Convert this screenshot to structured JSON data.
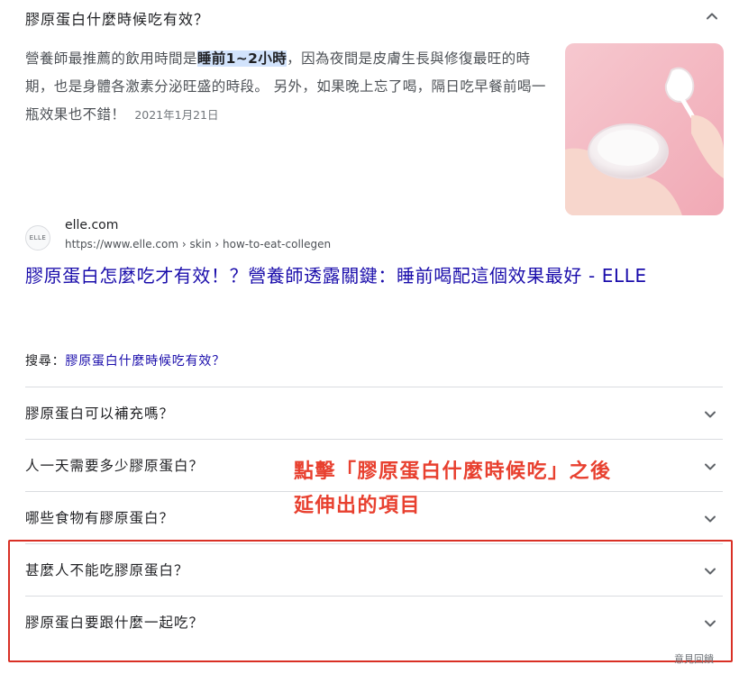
{
  "question": {
    "title": "膠原蛋白什麼時候吃有效？",
    "toggle_icon": "chevron-up-icon"
  },
  "answer": {
    "text_before": "營養師最推薦的飲用時間是",
    "highlight": "睡前1~2小時",
    "text_after": "，因為夜間是皮膚生長與修復最旺的時期，也是身體各激素分泌旺盛的時段。 另外，如果晚上忘了喝，隔日吃早餐前喝一瓶效果也不錯！",
    "date": "2021年1月21日"
  },
  "thumbnail": {
    "icon": "collagen-powder-image"
  },
  "source": {
    "favicon_text": "ELLE",
    "site_name": "elle.com",
    "url": "https://www.elle.com › skin › how-to-eat-collegen",
    "title": "膠原蛋白怎麼吃才有效！？營養師透露關鍵：睡前喝配這個效果最好 - ELLE"
  },
  "search": {
    "label": "搜尋：",
    "query": "膠原蛋白什麼時候吃有效？"
  },
  "related_questions": [
    {
      "text": "膠原蛋白可以補充嗎？",
      "icon": "chevron-down-icon"
    },
    {
      "text": "人一天需要多少膠原蛋白？",
      "icon": "chevron-down-icon"
    },
    {
      "text": "哪些食物有膠原蛋白？",
      "icon": "chevron-down-icon"
    },
    {
      "text": "甚麼人不能吃膠原蛋白？",
      "icon": "chevron-down-icon"
    },
    {
      "text": "膠原蛋白要跟什麼一起吃？",
      "icon": "chevron-down-icon"
    }
  ],
  "annotation": {
    "line1": "點擊「膠原蛋白什麼時候吃」之後",
    "line2": "延伸出的項目",
    "color": "#e8402f"
  },
  "feedback": "意見回饋"
}
